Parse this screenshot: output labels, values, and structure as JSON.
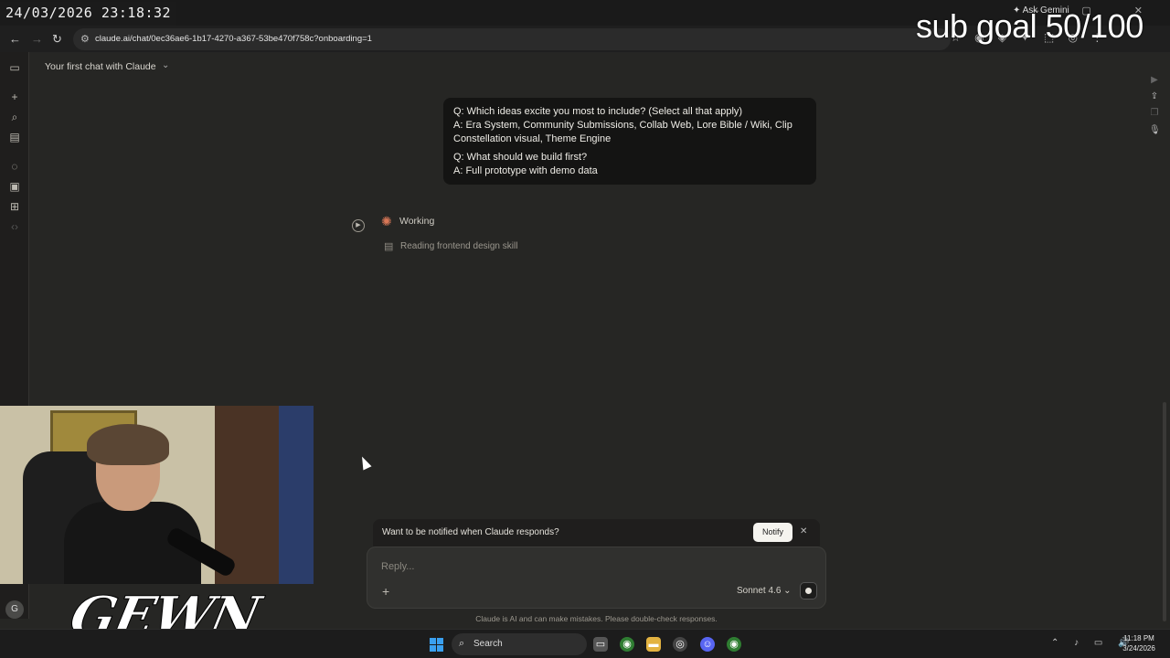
{
  "overlay": {
    "timestamp": "24/03/2026 23:18:32",
    "sub_goal": "sub goal 50/100",
    "logo": "GEWN"
  },
  "browser": {
    "url": "claude.ai/chat/0ec36ae6-1b17-4270-a367-53be470f758c?onboarding=1",
    "ask_gemini": "Ask Gemini"
  },
  "header": {
    "chat_title": "Your first chat with Claude"
  },
  "messages": {
    "q1": "Q: Which ideas excite you most to include? (Select all that apply)",
    "a1": "A: Era System, Community Submissions, Collab Web, Lore Bible / Wiki, Clip Constellation visual, Theme Engine",
    "q2": "Q: What should we build first?",
    "a2": "A: Full prototype with demo data"
  },
  "status": {
    "working": "Working",
    "step": "Reading frontend design skill"
  },
  "notify": {
    "text": "Want to be notified when Claude responds?",
    "button": "Notify"
  },
  "composer": {
    "placeholder": "Reply...",
    "model": "Sonnet 4.6"
  },
  "disclaimer": "Claude is AI and can make mistakes. Please double-check responses.",
  "user": {
    "initial": "G"
  },
  "taskbar": {
    "search": "Search",
    "time": "11:18 PM",
    "date": "3/24/2026"
  },
  "colors": {
    "background": "#262624",
    "accent": "#d97757",
    "bubble": "#141413"
  }
}
